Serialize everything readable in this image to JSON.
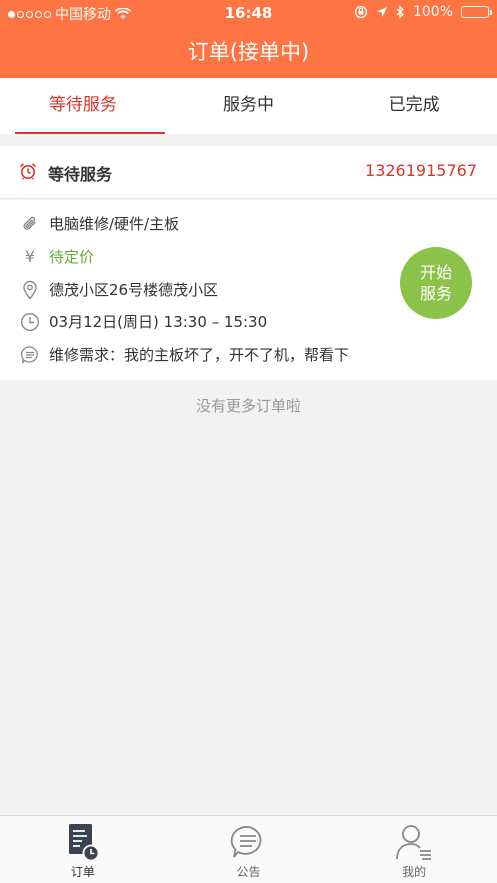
{
  "status_bar": {
    "carrier": "中国移动",
    "time": "16:48",
    "battery": "100%"
  },
  "nav": {
    "title": "订单(接单中)"
  },
  "tabs": [
    {
      "label": "等待服务",
      "active": true
    },
    {
      "label": "服务中",
      "active": false
    },
    {
      "label": "已完成",
      "active": false
    }
  ],
  "order": {
    "status": "等待服务",
    "phone": "13261915767",
    "category": "电脑维修/硬件/主板",
    "currency_symbol": "¥",
    "price": "待定价",
    "address": "德茂小区26号楼德茂小区",
    "time": "03月12日(周日) 13:30 – 15:30",
    "requirement": "维修需求：我的主板坏了，开不了机，帮看下",
    "start_button_line1": "开始",
    "start_button_line2": "服务"
  },
  "list_footer": "没有更多订单啦",
  "tabbar": [
    {
      "label": "订单",
      "icon": "orders-icon",
      "active": true
    },
    {
      "label": "公告",
      "icon": "announcement-icon",
      "active": false
    },
    {
      "label": "我的",
      "icon": "profile-icon",
      "active": false
    }
  ],
  "colors": {
    "header": "#fe7442",
    "accent_red": "#d9342b",
    "price_green": "#67ac32",
    "start_button": "#8bc34a"
  }
}
